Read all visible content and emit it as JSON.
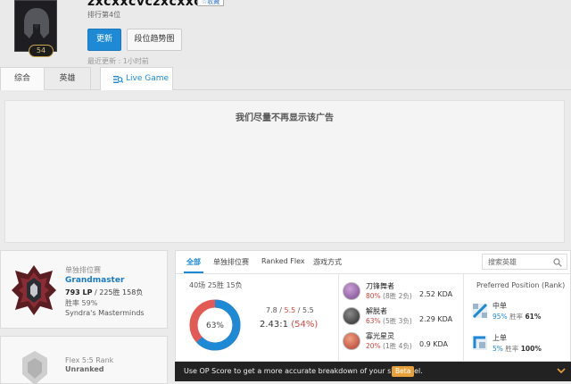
{
  "summoner": {
    "name": "zxcxxcvczxcxxcvc",
    "fav_label": "收藏",
    "rank_text": "排行第4位",
    "level": "54",
    "update_label": "更新",
    "tier_graph_label": "段位趋势图",
    "last_update": "最近更新 : 1小时前"
  },
  "tabs": [
    {
      "label": "综合"
    },
    {
      "label": "英雄"
    },
    {
      "label": "Live Game"
    }
  ],
  "ad": {
    "text": "我们尽量不再显示该广告"
  },
  "solo_rank": {
    "label": "单独排位赛",
    "tier": "Grandmaster",
    "lp": "793 LP",
    "record": " / 225胜 158负",
    "winrate": "胜率 59%",
    "league": "Syndra's Masterminds"
  },
  "flex_rank": {
    "label": "Flex 5:5 Rank",
    "tier": "Unranked"
  },
  "game_tabs": [
    {
      "label": "全部"
    },
    {
      "label": "单独排位赛"
    },
    {
      "label": "Ranked Flex"
    },
    {
      "label": "游戏方式"
    }
  ],
  "search": {
    "placeholder": "搜索英雄"
  },
  "summary": {
    "line": "40场 25胜 15负",
    "winrate_label": "63%",
    "winrate": 63,
    "kills": "7.8",
    "sep1": " / ",
    "deaths": "5.5",
    "sep2": " / ",
    "assists": "5.5",
    "ratio": "2.43:1",
    "ratio_pct": "(54%)"
  },
  "champions": [
    {
      "name": "刀锋舞者",
      "winrate": "80%",
      "record": " (8胜 2负)",
      "kda": "2.52 KDA",
      "color": "#7a4a8c"
    },
    {
      "name": "解脱者",
      "winrate": "63%",
      "record": " (5胜 3负)",
      "kda": "2.29 KDA",
      "color": "#3b3b3b"
    },
    {
      "name": "寡光星灵",
      "winrate": "20%",
      "record": " (1胜 4负)",
      "kda": "0.9 KDA",
      "color": "#b03a2e"
    }
  ],
  "positions": {
    "title": "Preferred Position (Rank)",
    "items": [
      {
        "name": "中单",
        "pct": "95%",
        "wr_label": "胜率 ",
        "wr": "61%"
      },
      {
        "name": "上单",
        "pct": "5%",
        "wr_label": "胜率 ",
        "wr": "100%"
      }
    ]
  },
  "opscore": {
    "text": "Use OP Score to get a more accurate breakdown of your skill level.",
    "beta": "Beta"
  },
  "colors": {
    "accent": "#1e8ad6",
    "loss": "#e35a54",
    "gold": "#c9a54b"
  }
}
